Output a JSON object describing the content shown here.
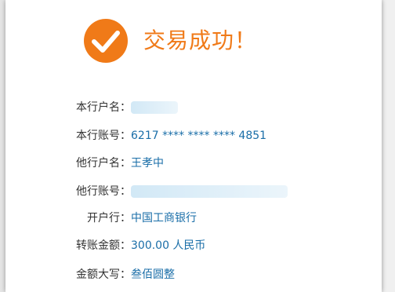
{
  "colors": {
    "accent": "#f07a18",
    "value_text": "#1a6ea8",
    "label_text": "#333333"
  },
  "icons": {
    "success": "checkmark-circle-icon"
  },
  "title": "交易成功！",
  "rows": [
    {
      "label": "本行户名：",
      "value": "",
      "redacted": true
    },
    {
      "label": "本行账号：",
      "value": "6217 **** **** **** 4851",
      "redacted": false
    },
    {
      "label": "他行户名：",
      "value": "王孝中",
      "redacted": false
    },
    {
      "label": "他行账号：",
      "value": "",
      "redacted": true
    },
    {
      "label": "开户行：",
      "value": "中国工商银行",
      "redacted": false
    },
    {
      "label": "转账金额：",
      "value": "300.00 人民币",
      "redacted": false
    },
    {
      "label": "金额大写：",
      "value": "叁佰圆整",
      "redacted": false
    }
  ]
}
